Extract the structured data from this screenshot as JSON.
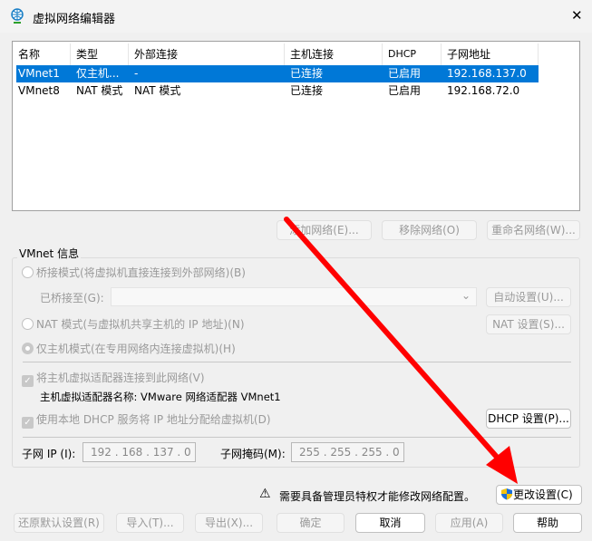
{
  "window": {
    "title": "虚拟网络编辑器",
    "close": "✕"
  },
  "table": {
    "headers": [
      "名称",
      "类型",
      "外部连接",
      "主机连接",
      "DHCP",
      "子网地址"
    ],
    "rows": [
      [
        "VMnet1",
        "仅主机...",
        "-",
        "已连接",
        "已启用",
        "192.168.137.0"
      ],
      [
        "VMnet8",
        "NAT 模式",
        "NAT 模式",
        "已连接",
        "已启用",
        "192.168.72.0"
      ]
    ]
  },
  "table_buttons": {
    "add": "添加网络(E)...",
    "remove": "移除网络(O)",
    "rename": "重命名网络(W)..."
  },
  "vmnet_info": {
    "legend": "VMnet 信息",
    "bridged": "桥接模式(将虚拟机直接连接到外部网络)(B)",
    "bridged_to": "已桥接至(G):",
    "auto_settings": "自动设置(U)...",
    "nat": "NAT 模式(与虚拟机共享主机的 IP 地址)(N)",
    "nat_settings": "NAT 设置(S)...",
    "host_only": "仅主机模式(在专用网络内连接虚拟机)(H)",
    "connect_adapter": "将主机虚拟适配器连接到此网络(V)",
    "adapter_name": "主机虚拟适配器名称: VMware 网络适配器 VMnet1",
    "use_dhcp": "使用本地 DHCP 服务将 IP 地址分配给虚拟机(D)",
    "dhcp_settings": "DHCP 设置(P)...",
    "subnet_ip_label": "子网 IP (I):",
    "subnet_ip": "192 . 168 . 137 . 0",
    "mask_label": "子网掩码(M):",
    "mask": "255 . 255 . 255 . 0"
  },
  "admin": {
    "warning": "需要具备管理员特权才能修改网络配置。",
    "change": "更改设置(C)"
  },
  "footer": {
    "restore": "还原默认设置(R)",
    "import": "导入(T)...",
    "export": "导出(X)...",
    "ok": "确定",
    "cancel": "取消",
    "apply": "应用(A)",
    "help": "帮助"
  },
  "colors": {
    "selection": "#0078d7",
    "arrow": "#ff0000"
  }
}
